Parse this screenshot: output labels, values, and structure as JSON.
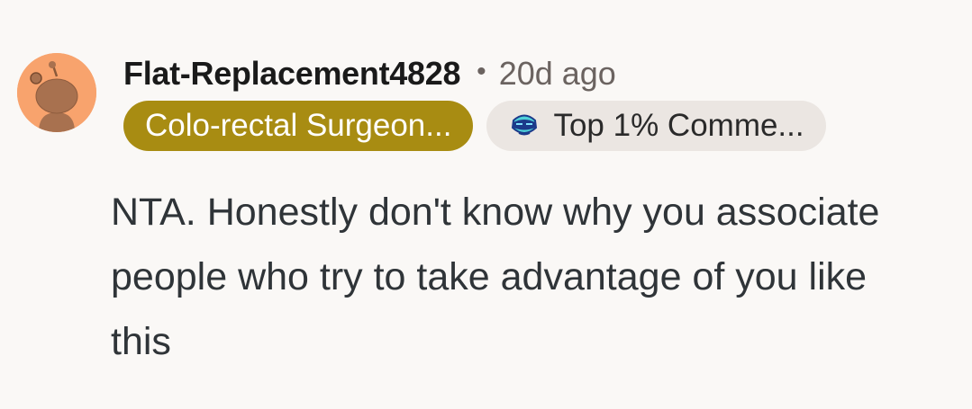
{
  "comment": {
    "author": "Flat-Replacement4828",
    "separator": "•",
    "timestamp": "20d ago",
    "user_flair": "Colo-rectal Surgeon...",
    "achievement_flair": "Top 1% Comme...",
    "body": "NTA. Honestly don't know why you associate people who try to take advantage of you like this",
    "avatar_icon": "snoo-avatar-icon",
    "achievement_icon": "top-commenter-icon",
    "colors": {
      "avatar_bg": "#f8a36d",
      "user_flair_bg": "#a88c12",
      "achievement_flair_bg": "#ebe6e2",
      "page_bg": "#faf8f6"
    }
  }
}
